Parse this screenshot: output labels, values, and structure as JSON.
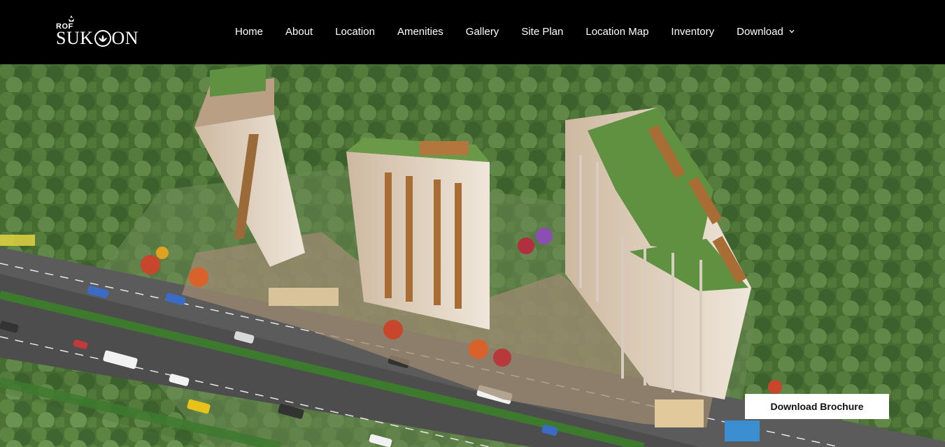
{
  "brand": {
    "prefix": "ROF",
    "name_left": "SUK",
    "name_right": "ON"
  },
  "nav": {
    "items": [
      {
        "label": "Home"
      },
      {
        "label": "About"
      },
      {
        "label": "Location"
      },
      {
        "label": "Amenities"
      },
      {
        "label": "Gallery"
      },
      {
        "label": "Site Plan"
      },
      {
        "label": "Location Map"
      },
      {
        "label": "Inventory"
      },
      {
        "label": "Download",
        "icon": "chevron-down-icon"
      }
    ]
  },
  "hero": {
    "cta_label": "Download Brochure",
    "image": "aerial-rendering-residential-towers"
  },
  "colors": {
    "navbar_bg": "#000000",
    "nav_text": "#ffffff",
    "button_bg": "#ffffff",
    "button_text": "#111111"
  }
}
